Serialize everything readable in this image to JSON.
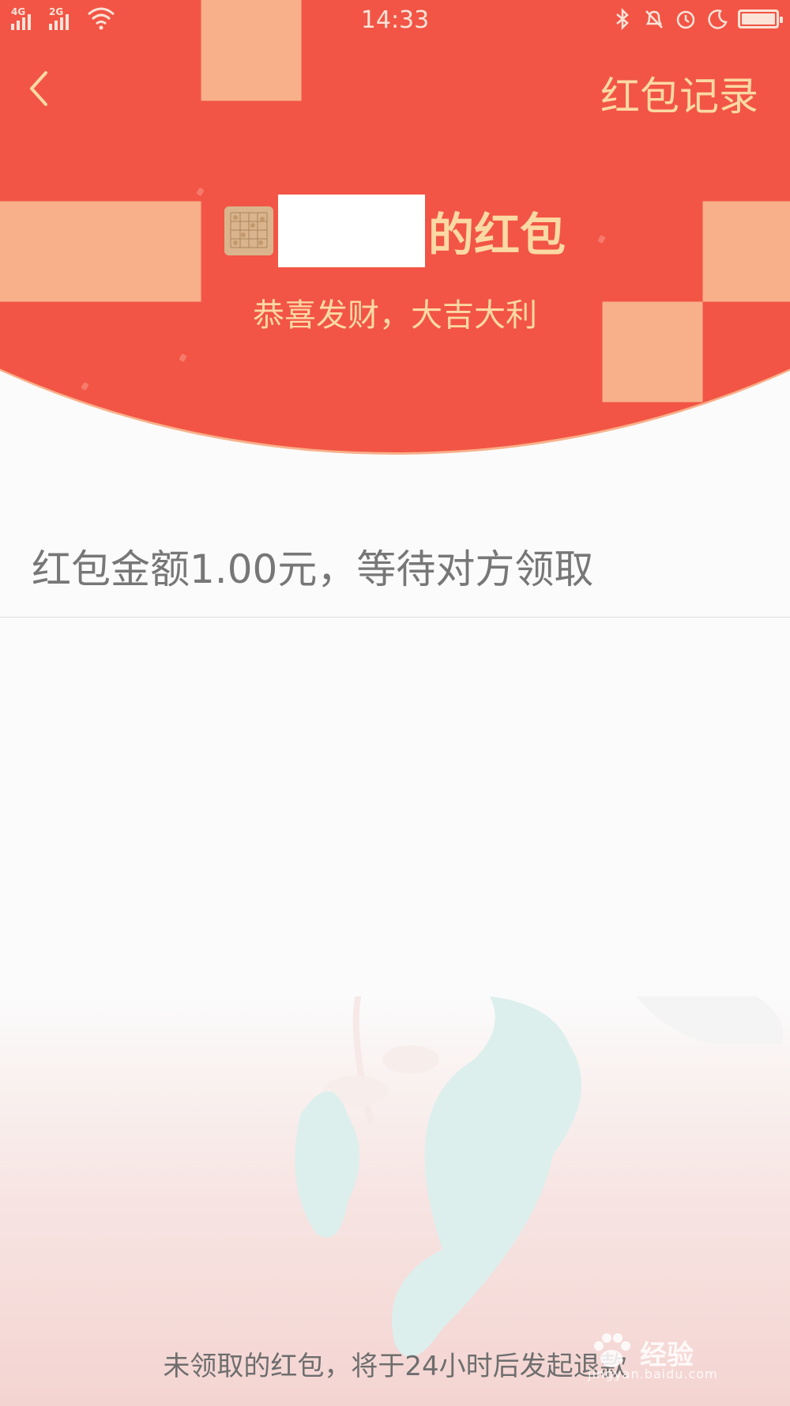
{
  "status_bar": {
    "time": "14:33",
    "network1": "4G",
    "network2": "2G"
  },
  "nav": {
    "back_icon": "chevron-left-icon",
    "records_label": "红包记录"
  },
  "header": {
    "title_suffix": "的红包",
    "greeting": "恭喜发财，大吉大利"
  },
  "details": {
    "amount_text": "红包金额1.00元，等待对方领取"
  },
  "footer": {
    "note": "未领取的红包，将于24小时后发起退款"
  },
  "watermark": {
    "brand": "经验",
    "site": "jingyan.baidu.com"
  },
  "colors": {
    "header": "#f25545",
    "gold_text": "#fbd9a4"
  }
}
